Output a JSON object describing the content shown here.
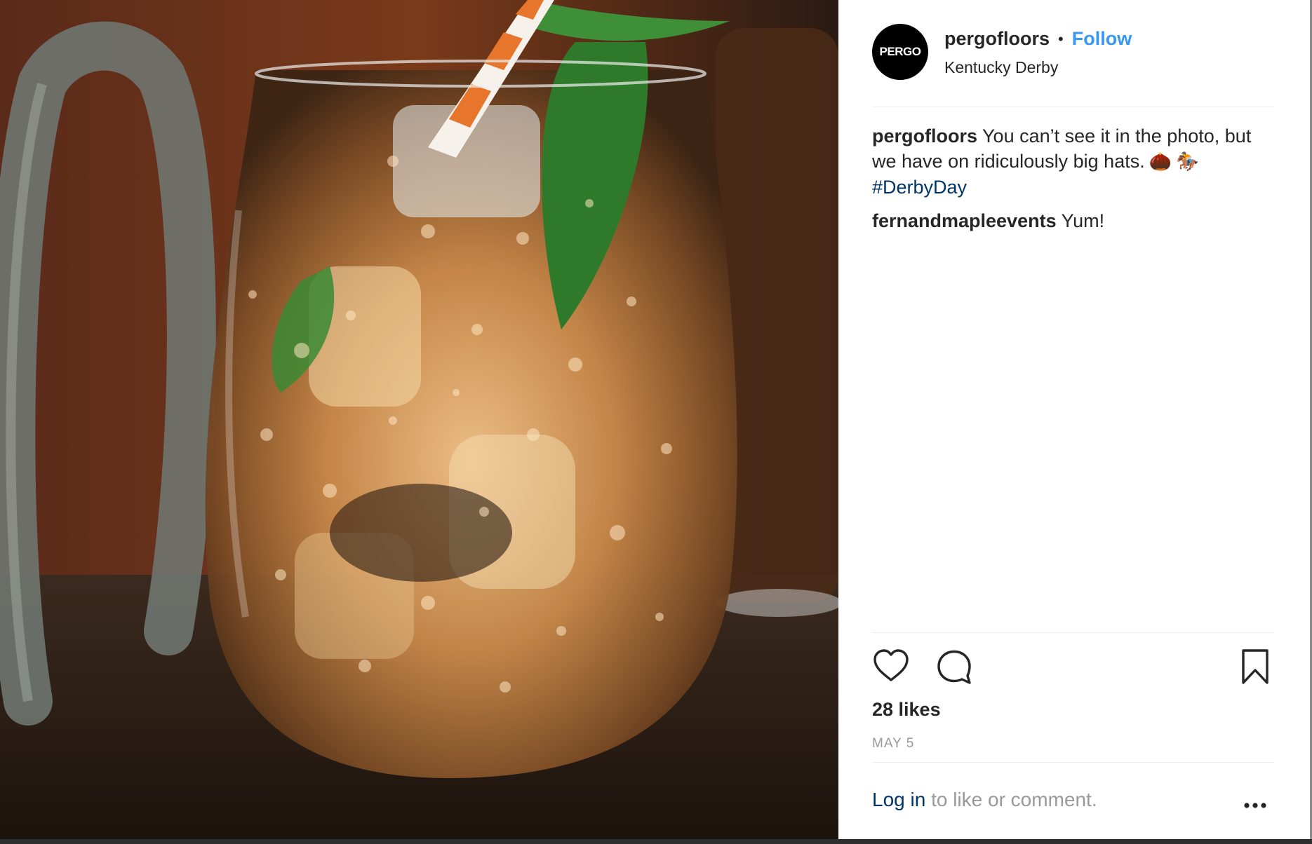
{
  "post": {
    "avatar_text": "PERGO",
    "username": "pergofloors",
    "separator": "•",
    "follow_label": "Follow",
    "location": "Kentucky Derby"
  },
  "caption": {
    "username": "pergofloors",
    "text": "You can’t see it in the photo, but we have on ridiculously big hats.",
    "emoji_1": "🌰",
    "emoji_2": "🏇",
    "hashtag": "#DerbyDay"
  },
  "comments": [
    {
      "username": "fernandmapleevents",
      "text": "Yum!"
    }
  ],
  "actions": {
    "like_icon": "heart-icon",
    "comment_icon": "comment-bubble-icon",
    "save_icon": "bookmark-icon"
  },
  "likes": "28 likes",
  "date": "MAY 5",
  "footer": {
    "login_link": "Log in",
    "login_rest": " to like or comment.",
    "more_icon": "more-options-icon"
  },
  "colors": {
    "link_blue": "#3897f0",
    "hashtag_blue": "#003569",
    "text": "#262626",
    "muted": "#999999"
  }
}
